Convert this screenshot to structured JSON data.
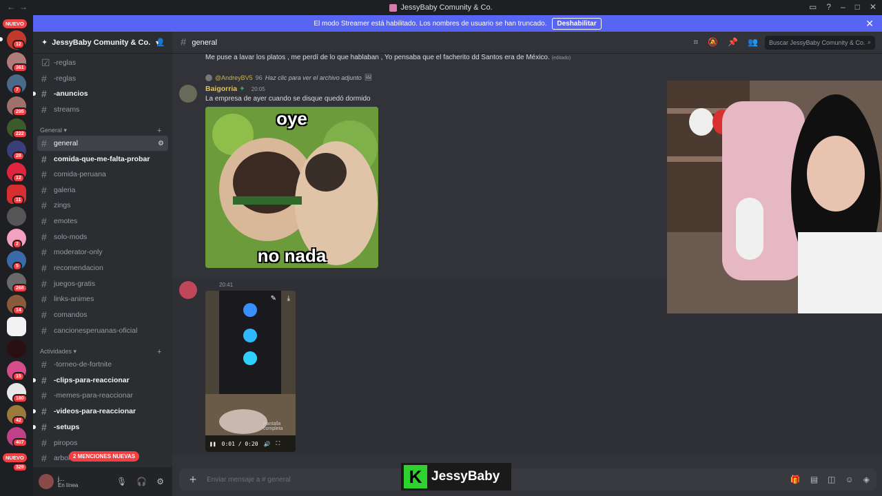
{
  "window": {
    "title": "JessyBaby Comunity & Co."
  },
  "servers": {
    "badges": [
      "12",
      "361",
      "7",
      "295",
      "222",
      "28",
      "12",
      "11",
      "2",
      "5",
      "268",
      "14",
      "15",
      "180",
      "42",
      "407",
      "329"
    ],
    "new_label": "NUEVO"
  },
  "streamer_banner": {
    "text": "El modo Streamer está habilitado. Los nombres de usuario se han truncado.",
    "button": "Deshabilitar"
  },
  "guild": {
    "name": "JessyBaby Comunity & Co."
  },
  "channels": {
    "reglas1": "-reglas",
    "reglas2": "-reglas",
    "anuncios": "-anuncios",
    "streams": "streams",
    "cat_general": "General",
    "general": "general",
    "comida": "comida-que-me-falta-probar",
    "comida_peruana": "comida-peruana",
    "galeria": "galeria",
    "zings": "zings",
    "emotes": "emotes",
    "solo_mods": "solo-mods",
    "moderator": "moderator-only",
    "recomendacion": "recomendacion",
    "juegos": "juegos-gratis",
    "links": "links-animes",
    "comandos": "comandos",
    "canciones": "cancionesperuanas-oficial",
    "cat_actividades": "Actividades",
    "torneo": "-torneo-de-fortnite",
    "clips": "-clips-para-reaccionar",
    "memes": "-memes-para-reaccionar",
    "videos": "-videos-para-reaccionar",
    "setups": "-setups",
    "piropos": "piropos",
    "arbol": "arbol"
  },
  "mentions_pill": "2 MENCIONES NUEVAS",
  "user": {
    "name": "j...",
    "status": "En línea"
  },
  "header": {
    "channel": "general",
    "search_placeholder": "Buscar JessyBaby Comunity & Co."
  },
  "messages": {
    "m1_text": "Me puse a lavar los platos , me perdí de lo que hablaban , Yo pensaba que el facherito dd Santos era de México.",
    "m1_edited": "(editado)",
    "reply_user": "@AndreyBV5",
    "reply_level": "96",
    "reply_text": "Haz clic para ver el archivo adjunto",
    "author": "Baigorria",
    "time": "20:05",
    "m2_text": "La empresa de ayer cuando se disque quedó dormido",
    "meme_top": "oye",
    "meme_bottom": "no nada",
    "m3_time": "20:41",
    "video_time": "0:01 / 0:20",
    "video_hover": "Pantalla completa"
  },
  "composer": {
    "placeholder": "Enviar mensaje a #  general"
  },
  "brand": {
    "name": "JessyBaby",
    "logo_letter": "K"
  }
}
